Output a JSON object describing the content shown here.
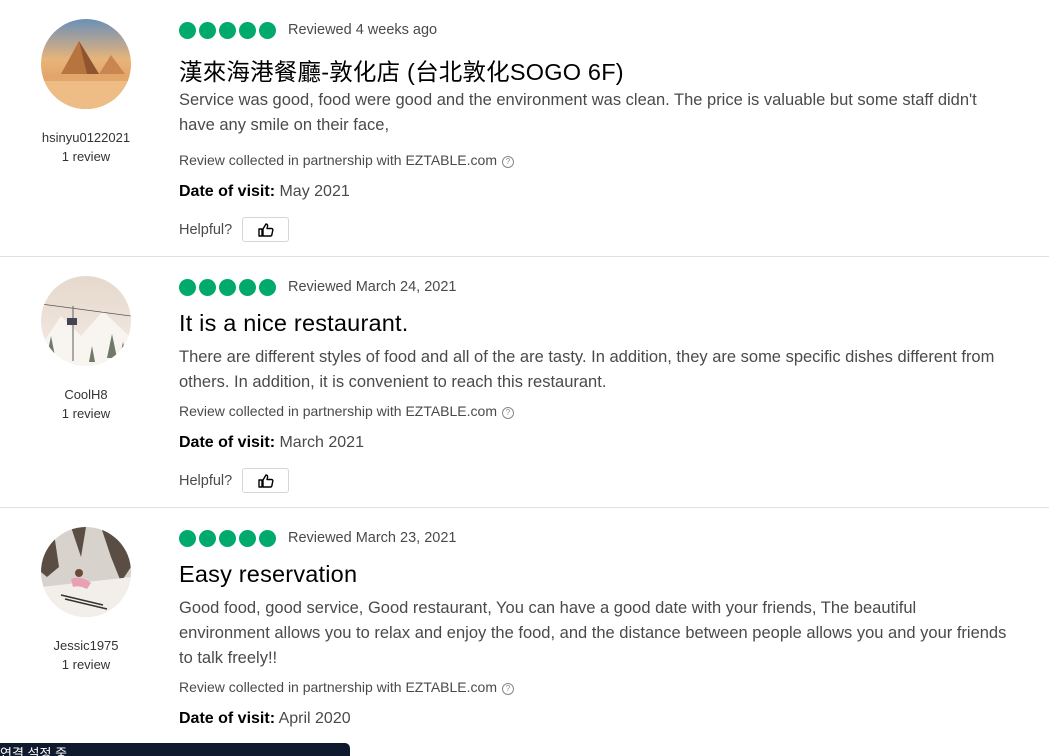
{
  "reviews": [
    {
      "user": {
        "name": "hsinyu0122021",
        "review_count": "1 review",
        "avatar": "desert-pyramids-avatar"
      },
      "rating": 5,
      "reviewed_date": "Reviewed 4 weeks ago",
      "title": "漢來海港餐廳-敦化店 (台北敦化SOGO 6F)",
      "body": "Service was good, food were good and the environment was clean. The price is valuable but some staff didn't have any smile on their face,",
      "partner_note": "Review collected in partnership with EZTABLE.com",
      "visit_label": "Date of visit:",
      "visit_value": "May 2021",
      "helpful_label": "Helpful?"
    },
    {
      "user": {
        "name": "CoolH8",
        "review_count": "1 review",
        "avatar": "ski-lift-avatar"
      },
      "rating": 5,
      "reviewed_date": "Reviewed March 24, 2021",
      "title": "It is a nice restaurant.",
      "body": "There are different styles of food and all of the are tasty. In addition, they are some specific dishes different from others. In addition, it is convenient to reach this restaurant.",
      "partner_note": "Review collected in partnership with EZTABLE.com",
      "visit_label": "Date of visit:",
      "visit_value": "March 2021",
      "helpful_label": "Helpful?"
    },
    {
      "user": {
        "name": "Jessic1975",
        "review_count": "1 review",
        "avatar": "skier-avatar"
      },
      "rating": 5,
      "reviewed_date": "Reviewed March 23, 2021",
      "title": "Easy reservation",
      "body": "Good food, good service, Good restaurant, You can have a good date with your friends, The beautiful environment allows you to relax and enjoy the food, and the distance between people allows you and your friends to talk freely!!",
      "partner_note": "Review collected in partnership with EZTABLE.com",
      "visit_label": "Date of visit:",
      "visit_value": "April 2020"
    }
  ],
  "toast": {
    "text": "연결 설정 중..."
  },
  "colors": {
    "bubble": "#00aa6c",
    "toast_bg": "#101a2e"
  },
  "icons": {
    "info": "info-circle-icon",
    "helpful": "thumbs-up-icon"
  }
}
